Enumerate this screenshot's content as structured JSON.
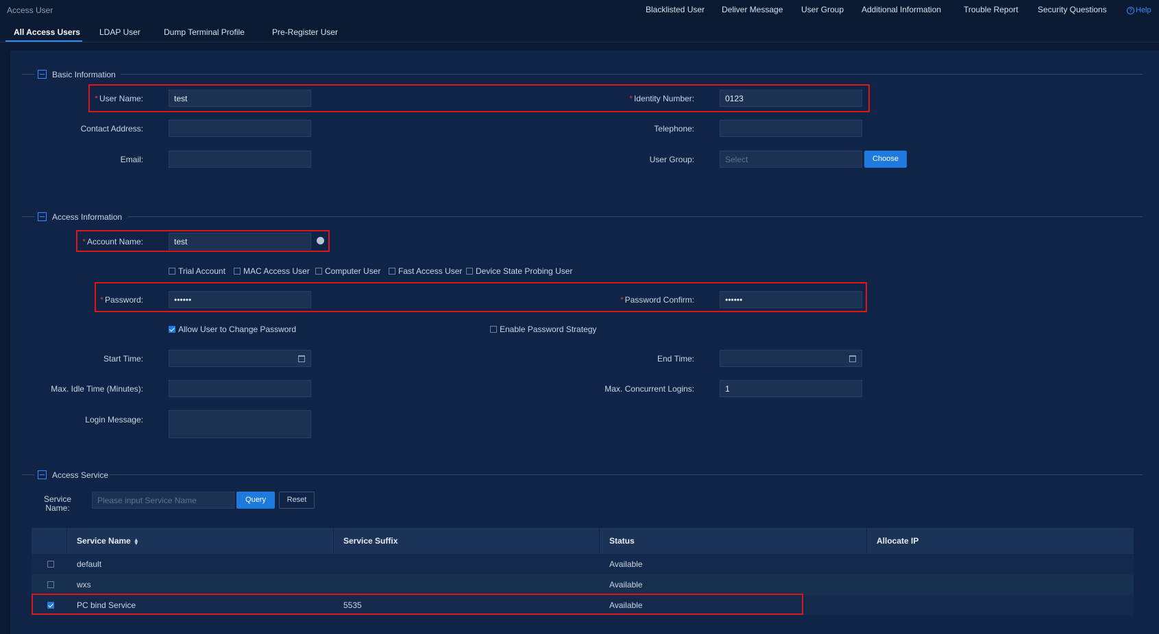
{
  "app": {
    "title": "Access User"
  },
  "topnav": {
    "items": [
      "Blacklisted User",
      "Deliver Message",
      "User Group",
      "Additional Information",
      "Trouble Report",
      "Security Questions"
    ],
    "help": "Help"
  },
  "tabs": [
    "All Access Users",
    "LDAP User",
    "Dump Terminal Profile",
    "Pre-Register User"
  ],
  "basic": {
    "title": "Basic Information",
    "user_name_label": "User Name:",
    "user_name_value": "test",
    "identity_label": "Identity Number:",
    "identity_value": "0123",
    "contact_label": "Contact Address:",
    "contact_value": "",
    "telephone_label": "Telephone:",
    "telephone_value": "",
    "email_label": "Email:",
    "email_value": "",
    "group_label": "User Group:",
    "group_placeholder": "Select",
    "choose_label": "Choose"
  },
  "access": {
    "title": "Access Information",
    "account_label": "Account Name:",
    "account_value": "test",
    "checkboxes": [
      {
        "label": "Trial Account",
        "checked": false
      },
      {
        "label": "MAC Access User",
        "checked": false
      },
      {
        "label": "Computer User",
        "checked": false
      },
      {
        "label": "Fast Access User",
        "checked": false
      },
      {
        "label": "Device State Probing User",
        "checked": false
      }
    ],
    "password_label": "Password:",
    "password_value": "••••••",
    "password_confirm_label": "Password Confirm:",
    "password_confirm_value": "••••••",
    "allow_change_label": "Allow User to Change Password",
    "allow_change_checked": true,
    "enable_strategy_label": "Enable Password Strategy",
    "enable_strategy_checked": false,
    "start_label": "Start Time:",
    "end_label": "End Time:",
    "idle_label": "Max. Idle Time (Minutes):",
    "idle_value": "",
    "concurrent_label": "Max. Concurrent Logins:",
    "concurrent_value": "1",
    "login_msg_label": "Login Message:"
  },
  "service": {
    "title": "Access Service",
    "name_label_line1": "Service",
    "name_label_line2": "Name:",
    "search_placeholder": "Please input Service Name",
    "query_label": "Query",
    "reset_label": "Reset",
    "columns": [
      "Service Name",
      "Service Suffix",
      "Status",
      "Allocate IP"
    ],
    "rows": [
      {
        "checked": false,
        "name": "default",
        "suffix": "",
        "status": "Available",
        "ip": ""
      },
      {
        "checked": false,
        "name": "wxs",
        "suffix": "",
        "status": "Available",
        "ip": ""
      },
      {
        "checked": true,
        "name": "PC bind Service",
        "suffix": "5535",
        "status": "Available",
        "ip": ""
      }
    ]
  },
  "colors": {
    "accent": "#1f7ae0",
    "highlight": "#e01515",
    "required": "#e03a3a",
    "background": "#0b1a33"
  }
}
